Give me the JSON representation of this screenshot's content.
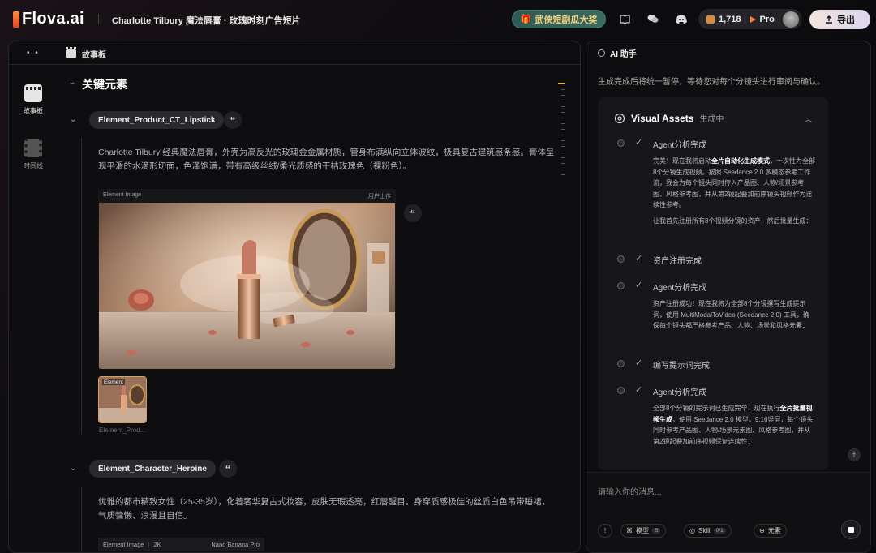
{
  "app": {
    "logo_text": "Flova.ai",
    "project_title": "Charlotte Tilbury 魔法唇膏 · 玫瑰时刻广告短片"
  },
  "topbar": {
    "promo_label": "武侠短剧瓜大奖",
    "credits": "1,718",
    "plan": "Pro",
    "export_label": "导出",
    "icons": [
      "book-icon",
      "wechat-icon",
      "discord-icon",
      "coin-icon",
      "pro-icon",
      "avatar"
    ]
  },
  "left_panel": {
    "header_label": "故事板",
    "sidebar": [
      {
        "label": "故事板",
        "icon": "storyboard-icon",
        "active": true
      },
      {
        "label": "时间线",
        "icon": "timeline-icon",
        "active": false
      }
    ],
    "section_title": "关键元素",
    "elements": [
      {
        "name": "Element_Product_CT_Lipstick",
        "description": "Charlotte Tilbury 经典魔法唇膏，外壳为高反光的玫瑰金金属材质，管身布满纵向立体波纹，极具复古建筑感条感。膏体呈现平滑的水滴形切面，色泽饱满，带有高级丝绒/柔光质感的干枯玫瑰色（裸粉色）。",
        "image_card_label": "Element Image",
        "image_card_action": "用户上传",
        "thumb_label": "Element",
        "thumb_caption": "Element_Prod..."
      },
      {
        "name": "Element_Character_Heroine",
        "description": "优雅的都市精致女性（25-35岁），化着奢华复古式妆容，皮肤无瑕透亮，红唇醒目。身穿质感极佳的丝质白色吊带睡裙，气质慵懒、浪漫且自信。",
        "meta": [
          "Element Image",
          "2K",
          "Nano Banana Pro"
        ]
      }
    ]
  },
  "right_panel": {
    "title": "AI 助手",
    "intro": "生成完成后将统一暂停，等待您对每个分镜头进行审阅与确认。",
    "assets_title": "Visual Assets",
    "assets_status": "生成中",
    "steps": [
      {
        "title": "Agent分析完成",
        "body_pre": "完美！现在我将启动",
        "body_bold": "全片自动化生成模式",
        "body_post": "，一次性为全部8个分镜生成视频。按照 Seedance 2.0 多模态参考工作流，我会为每个镜头同时传入产品图、人物/场景参考图、风格参考图，并从第2镜起叠加前序镜头视频作为连续性参考。",
        "body2": "让我首先注册所有8个视频分镜的资产，然后批量生成："
      },
      {
        "title": "资产注册完成"
      },
      {
        "title": "Agent分析完成",
        "body_pre": "资产注册成功！现在我将为全部8个分镜撰写生成提示词，使用 MultiModalToVideo (Seedance 2.0) 工具，确保每个镜头都严格参考产品、人物、场景和风格元素："
      },
      {
        "title": "编写提示词完成"
      },
      {
        "title": "Agent分析完成",
        "body_pre": "全部8个分镜的提示词已生成完毕！现在执行",
        "body_bold": "全片批量视频生成",
        "body_post": "，使用 Seedance 2.0 模型，9:16竖屏，每个镜头同时参考产品图、人物/场景元素图、风格参考图，并从第2镜起叠加前序视频保证连续性："
      }
    ],
    "input_placeholder": "请输入你的消息...",
    "toolbar": [
      {
        "label": "模型",
        "badge": "S"
      },
      {
        "label": "Skill",
        "badge": "0/1"
      },
      {
        "label": "元素",
        "badge": ""
      }
    ]
  },
  "colors": {
    "accent_gold": "#e6b74a",
    "check_green": "#8bb77f",
    "promo_bg": "#2e5a55"
  }
}
